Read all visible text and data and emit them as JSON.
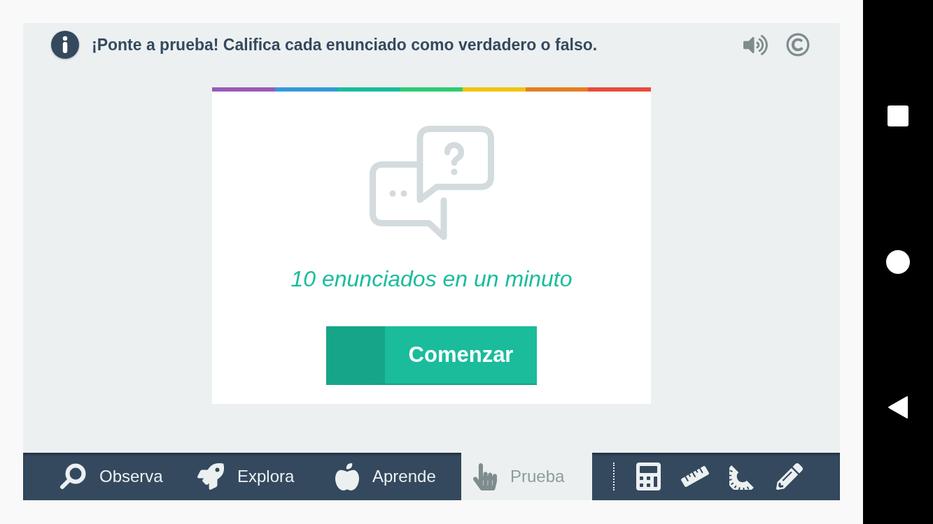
{
  "header": {
    "instruction": "¡Ponte a prueba! Califica cada enunciado como verdadero o falso."
  },
  "card": {
    "subtitle": "10 enunciados en un minuto",
    "start_button": "Comenzar"
  },
  "nav_tabs": [
    {
      "label": "Observa",
      "selected": false
    },
    {
      "label": "Explora",
      "selected": false
    },
    {
      "label": "Aprende",
      "selected": false
    },
    {
      "label": "Prueba",
      "selected": true
    }
  ]
}
